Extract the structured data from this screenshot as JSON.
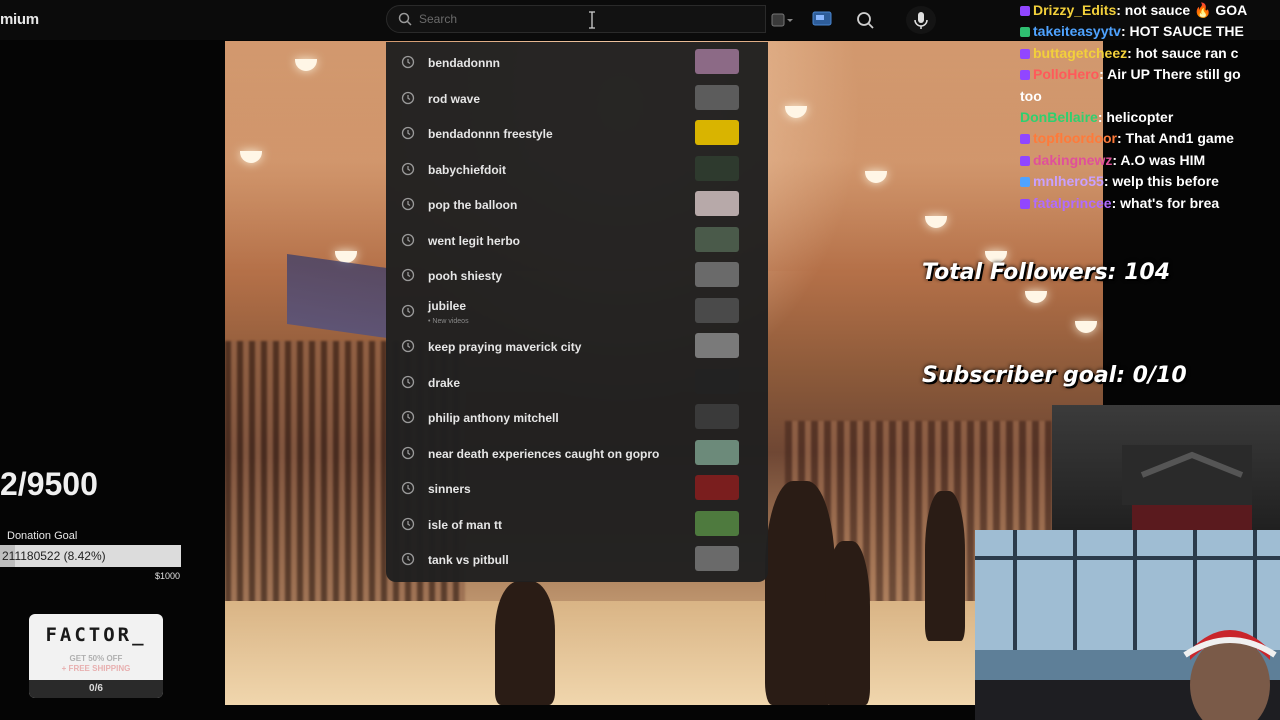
{
  "header": {
    "brand": "mium",
    "search_placeholder": "Search"
  },
  "search_suggestions": [
    {
      "text": "bendadonnn",
      "sub": "",
      "thumb_color": "#8c6a86"
    },
    {
      "text": "rod wave",
      "sub": "",
      "thumb_color": "#5c5c5c"
    },
    {
      "text": "bendadonnn freestyle",
      "sub": "",
      "thumb_color": "#d9b400"
    },
    {
      "text": "babychiefdoit",
      "sub": "",
      "thumb_color": "#2e3a2e"
    },
    {
      "text": "pop the balloon",
      "sub": "",
      "thumb_color": "#b7a9a9"
    },
    {
      "text": "went legit herbo",
      "sub": "",
      "thumb_color": "#4a5a4a"
    },
    {
      "text": "pooh shiesty",
      "sub": "",
      "thumb_color": "#6a6a6a"
    },
    {
      "text": "jubilee",
      "sub": "• New videos",
      "thumb_color": "#4a4a4a"
    },
    {
      "text": "keep praying maverick city",
      "sub": "",
      "thumb_color": "#7a7a7a"
    },
    {
      "text": "drake",
      "sub": "",
      "thumb_color": "#222222"
    },
    {
      "text": "philip anthony mitchell",
      "sub": "",
      "thumb_color": "#3a3a3a"
    },
    {
      "text": "near death experiences caught on gopro",
      "sub": "",
      "thumb_color": "#6c8a7a"
    },
    {
      "text": "sinners",
      "sub": "",
      "thumb_color": "#7a1e1e"
    },
    {
      "text": "isle of man tt",
      "sub": "",
      "thumb_color": "#4e7a3e"
    },
    {
      "text": "tank vs pitbull",
      "sub": "",
      "thumb_color": "#6a6a6a"
    }
  ],
  "chat": [
    {
      "user": "Drizzy_Edits",
      "color": "#f2d03b",
      "msg": " not sauce 🔥 GOA",
      "badge": "purple"
    },
    {
      "user": "takeiteasyytv",
      "color": "#4fa3ff",
      "msg": " HOT SAUCE THE",
      "badge": "green"
    },
    {
      "user": "buttagetcheez",
      "color": "#f2d03b",
      "msg": " hot sauce ran c",
      "badge": "purple"
    },
    {
      "user": "PolloHero",
      "color": "#ff5a5a",
      "msg": " Air UP There still go",
      "badge": "purple"
    },
    {
      "user": "",
      "color": "#ffffff",
      "msg": "too",
      "badge": ""
    },
    {
      "user": "DonBellaire",
      "color": "#2fd06f",
      "msg": " helicopter",
      "badge": ""
    },
    {
      "user": "topfloordoor",
      "color": "#ff7a3a",
      "msg": " That And1 game",
      "badge": "purple"
    },
    {
      "user": "dakingnewz",
      "color": "#e0509a",
      "msg": " A.O was HIM",
      "badge": "purple"
    },
    {
      "user": "mnlhero55",
      "color": "#c9a0ff",
      "msg": " welp this before",
      "badge": "blue"
    },
    {
      "user": "fatalprincee",
      "color": "#b06cff",
      "msg": " what's for brea",
      "badge": "purple"
    }
  ],
  "overlay": {
    "followers": "Total Followers: 104",
    "subscriber_goal": "Subscriber goal: 0/10"
  },
  "left_panel": {
    "sub_count": "2/9500",
    "donation_label": "Donation Goal",
    "donation_amount": "211180522 (8.42%)",
    "donation_progress_fraction": 0.0842,
    "donation_max": "$1000"
  },
  "factor_ad": {
    "logo": "FACTOR_",
    "offer_line1": "GET 50% OFF",
    "offer_line2": "+ FREE SHIPPING",
    "count": "0/6"
  },
  "colors": {
    "dropdown_bg": "#202020",
    "topbar_bg": "#0b0b0b"
  }
}
